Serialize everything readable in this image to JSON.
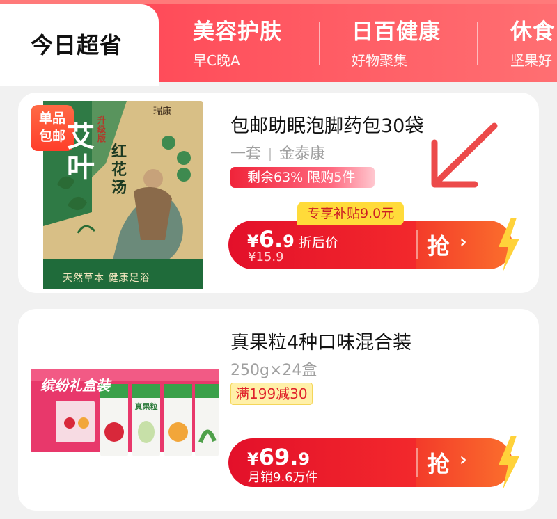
{
  "tabs": {
    "active": {
      "label": "今日超省"
    },
    "items": [
      {
        "title": "美容护肤",
        "subtitle": "早C晚A"
      },
      {
        "title": "日百健康",
        "subtitle": "好物聚集"
      },
      {
        "title": "休食",
        "subtitle": "坚果好"
      }
    ]
  },
  "products": [
    {
      "title": "包邮助眠泡脚药包30袋",
      "spec": "一套",
      "brand": "金泰康",
      "badge": "剩余63% 限购5件",
      "price_currency": "¥",
      "price_int": "6.",
      "price_dec": "9",
      "price_label": "折后价",
      "old_price": "¥15.9",
      "subsidy": "专享补贴9.0元",
      "grab_label": "抢",
      "grab_arrow": "›",
      "image": {
        "corner_badge_line1": "单品",
        "corner_badge_line2": "包邮",
        "brand_mark": "瑞康",
        "big_char": "艾叶",
        "side_title": "红花汤",
        "upgrade_tag": "升级版",
        "slogan": "天然草本 健康足浴"
      }
    },
    {
      "title": "真果粒4种口味混合装",
      "spec": "250g×24盒",
      "badge": "满199减30",
      "price_currency": "¥",
      "price_int": "69.",
      "price_dec": "9",
      "sales": "月销9.6万件",
      "grab_label": "抢",
      "grab_arrow": "›",
      "image": {
        "box_text": "缤纷礼盒装",
        "carton_label": "真果粒"
      }
    }
  ],
  "colors": {
    "tab_bg": "#ff4a58",
    "price_red": "#e3102a",
    "subsidy_yellow": "#ffdb3a",
    "arrow_red": "#ec4a4a"
  }
}
